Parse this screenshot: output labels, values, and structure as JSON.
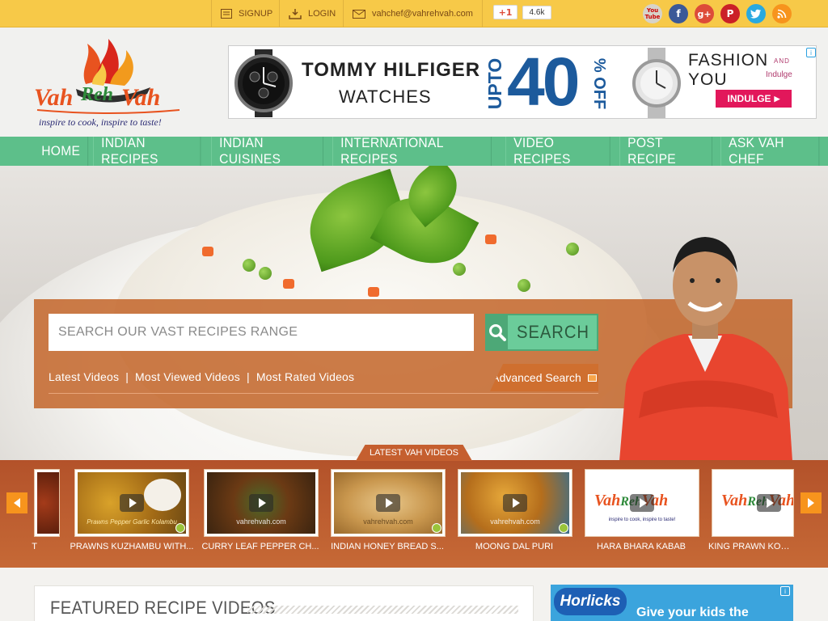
{
  "topbar": {
    "signup": "SIGNUP",
    "login": "LOGIN",
    "email": "vahchef@vahrehvah.com",
    "gplus_label": "+1",
    "gplus_count": "4.6k",
    "social_icons": [
      "youtube-icon",
      "facebook-icon",
      "google-plus-icon",
      "pinterest-icon",
      "twitter-icon",
      "rss-icon"
    ],
    "youtube_text": "You Tube"
  },
  "header": {
    "logo_text": [
      "Vah",
      "Reh",
      "Vah"
    ],
    "tagline": "inspire to cook, inspire to taste!"
  },
  "banner_ad": {
    "brand": "TOMMY HILFIGER",
    "product": "WATCHES",
    "upto": "UPTO",
    "discount": "40",
    "percent": "% OFF",
    "partner": "FASHION",
    "partner_and": "AND",
    "partner_you": "YOU",
    "partner_small": "Indulge",
    "cta": "INDULGE",
    "adchoice": "i"
  },
  "nav": {
    "items": [
      "HOME",
      "INDIAN RECIPES",
      "INDIAN CUISINES",
      "INTERNATIONAL RECIPES",
      "VIDEO RECIPES",
      "POST RECIPE",
      "ASK VAH CHEF"
    ]
  },
  "search": {
    "placeholder": "SEARCH OUR VAST RECIPES RANGE",
    "button": "SEARCH",
    "links": [
      "Latest Videos",
      "Most Viewed Videos",
      "Most Rated Videos"
    ],
    "separator": "|",
    "advanced": "Advanced Search"
  },
  "videos": {
    "section_label": "LATEST VAH VIDEOS",
    "items": [
      {
        "title": "T"
      },
      {
        "title": "PRAWNS KUZHAMBU WITH..."
      },
      {
        "title": "CURRY LEAF PEPPER CH..."
      },
      {
        "title": "INDIAN HONEY BREAD S..."
      },
      {
        "title": "MOONG DAL PURI"
      },
      {
        "title": "HARA BHARA KABAB"
      },
      {
        "title": "KING PRAWN KORM..."
      }
    ],
    "thumb_caption": "Prawns Pepper Garlic Kolambu",
    "watermark": "vahrehvah.com",
    "watermark_short": "vahrehvah.com",
    "thumb_logo": [
      "Vah",
      "Reh",
      "Vah"
    ],
    "thumb_logo_tag": "inspire to cook, inspire to taste!"
  },
  "featured": {
    "title": "FEATURED RECIPE VIDEOS"
  },
  "side_ad": {
    "brand": "Horlicks",
    "text": "Give your kids the",
    "adchoice": "i"
  },
  "colors": {
    "topbar": "#f7c948",
    "nav": "#5dbf8a",
    "search_panel": "#c4662b",
    "search_button": "#6bcc9a",
    "videos_strip": "#c66936",
    "arrow": "#f7941d"
  }
}
